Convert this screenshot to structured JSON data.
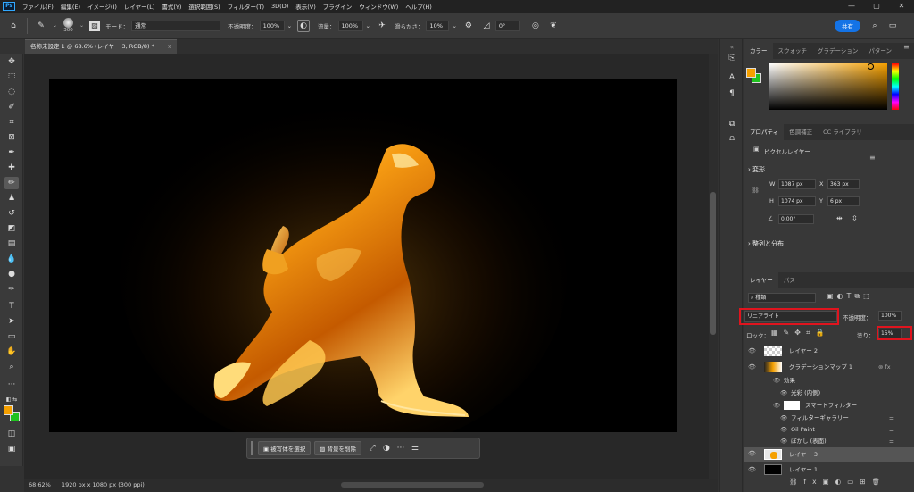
{
  "menubar": {
    "items": [
      "ファイル(F)",
      "編集(E)",
      "イメージ(I)",
      "レイヤー(L)",
      "書式(Y)",
      "選択範囲(S)",
      "フィルター(T)",
      "3D(D)",
      "表示(V)",
      "プラグイン",
      "ウィンドウ(W)",
      "ヘルプ(H)"
    ],
    "logo": "Ps"
  },
  "options": {
    "brush_size": "300",
    "mode_label": "モード：",
    "mode_value": "通常",
    "opacity_label": "不透明度：",
    "opacity_value": "100%",
    "flow_label": "流量：",
    "flow_value": "100%",
    "smoothing_label": "滑らかさ：",
    "smoothing_value": "10%",
    "angle_value": "0°",
    "share_label": "共有"
  },
  "document": {
    "tab_title": "名称未設定 1 @ 68.6% (レイヤー 3, RGB/8) *",
    "zoom": "68.62%",
    "size_info": "1920 px x 1080 px (300 ppi)"
  },
  "context_bar": {
    "select_subject": "被写体を選択",
    "remove_background": "背景を削除"
  },
  "color_panel": {
    "tabs": [
      "カラー",
      "スウォッチ",
      "グラデーション",
      "パターン"
    ],
    "foreground": "#f5a000",
    "background": "#1fc21f"
  },
  "properties_panel": {
    "tabs": [
      "プロパティ",
      "色調補正",
      "CC ライブラリ"
    ],
    "type_label": "ピクセルレイヤー",
    "transform_title": "変形",
    "w_label": "W",
    "w_value": "1087 px",
    "h_label": "H",
    "h_value": "1074 px",
    "x_label": "X",
    "x_value": "363 px",
    "y_label": "Y",
    "y_value": "6 px",
    "angle_value": "0.00°",
    "align_title": "整列と分布"
  },
  "layers_panel": {
    "tabs": [
      "レイヤー",
      "パス"
    ],
    "filter_kind": "種類",
    "blend_mode": "リニアライト",
    "opacity_label": "不透明度：",
    "opacity_value": "100%",
    "lock_label": "ロック：",
    "fill_label": "塗り：",
    "fill_value": "15%",
    "layers": [
      {
        "name": "レイヤー 2"
      },
      {
        "name": "グラデーションマップ 1"
      },
      {
        "name": "効果"
      },
      {
        "name": "光彩 (内側)"
      },
      {
        "name": "スマートフィルター"
      },
      {
        "name": "フィルターギャラリー"
      },
      {
        "name": "Oil Paint"
      },
      {
        "name": "ぼかし (表面)"
      },
      {
        "name": "レイヤー 3"
      },
      {
        "name": "レイヤー 1"
      }
    ]
  }
}
